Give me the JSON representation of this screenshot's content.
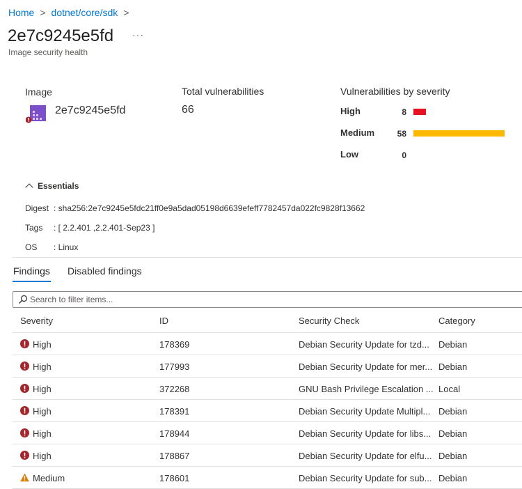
{
  "breadcrumb": [
    "Home",
    "dotnet/core/sdk"
  ],
  "title": "2e7c9245e5fd",
  "more": "···",
  "subtitle": "Image security health",
  "summary": {
    "image_label": "Image",
    "image_name": "2e7c9245e5fd",
    "total_label": "Total vulnerabilities",
    "total": "66",
    "severity_label": "Vulnerabilities by severity",
    "severities": [
      {
        "name": "High",
        "count": "8",
        "value": 8,
        "color": "#e81123"
      },
      {
        "name": "Medium",
        "count": "58",
        "value": 58,
        "color": "#fcb900"
      },
      {
        "name": "Low",
        "count": "0",
        "value": 0,
        "color": "#0078d4"
      }
    ]
  },
  "essentials": {
    "label": "Essentials",
    "rows": [
      {
        "key": "Digest",
        "value": ": sha256:2e7c9245e5fdc21ff0e9a5dad05198d6639efeff7782457da022fc9828f13662"
      },
      {
        "key": "Tags",
        "value": ": [ 2.2.401 ,2.2.401-Sep23 ]"
      },
      {
        "key": "OS",
        "value": ": Linux"
      }
    ]
  },
  "tabs": [
    "Findings",
    "Disabled findings"
  ],
  "search": {
    "placeholder": "Search to filter items..."
  },
  "table": {
    "columns": [
      "Severity",
      "ID",
      "Security Check",
      "Category"
    ],
    "rows": [
      {
        "severity": "High",
        "id": "178369",
        "check": "Debian Security Update for tzd...",
        "category": "Debian"
      },
      {
        "severity": "High",
        "id": "177993",
        "check": "Debian Security Update for mer...",
        "category": "Debian"
      },
      {
        "severity": "High",
        "id": "372268",
        "check": "GNU Bash Privilege Escalation ...",
        "category": "Local"
      },
      {
        "severity": "High",
        "id": "178391",
        "check": "Debian Security Update Multipl...",
        "category": "Debian"
      },
      {
        "severity": "High",
        "id": "178944",
        "check": "Debian Security Update for libs...",
        "category": "Debian"
      },
      {
        "severity": "High",
        "id": "178867",
        "check": "Debian Security Update for elfu...",
        "category": "Debian"
      },
      {
        "severity": "Medium",
        "id": "178601",
        "check": "Debian Security Update for sub...",
        "category": "Debian"
      }
    ]
  }
}
